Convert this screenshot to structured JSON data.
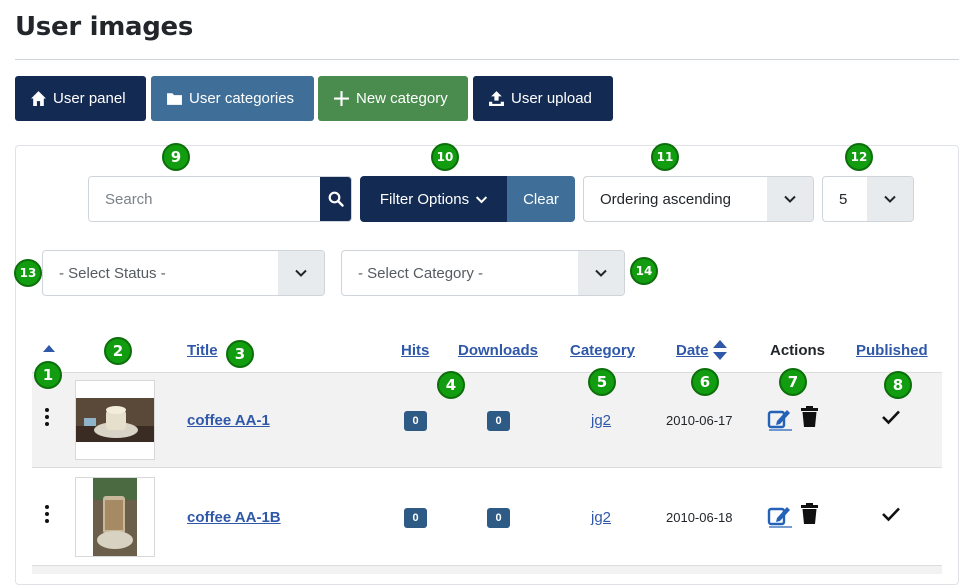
{
  "page": {
    "title": "User images"
  },
  "toolbar": {
    "user_panel": "User panel",
    "user_categories": "User categories",
    "new_category": "New category",
    "user_upload": "User upload"
  },
  "filters": {
    "search_placeholder": "Search",
    "filter_options": "Filter Options",
    "clear": "Clear",
    "ordering": "Ordering ascending",
    "limit": "5",
    "status": "- Select Status -",
    "category": "- Select Category -"
  },
  "table": {
    "headers": {
      "title": "Title",
      "hits": "Hits",
      "downloads": "Downloads",
      "category": "Category",
      "date": "Date",
      "actions": "Actions",
      "published": "Published"
    },
    "rows": [
      {
        "title": "coffee AA-1",
        "hits": "0",
        "downloads": "0",
        "category": "jg2",
        "date": "2010-06-17",
        "published": true
      },
      {
        "title": "coffee AA-1B",
        "hits": "0",
        "downloads": "0",
        "category": "jg2",
        "date": "2010-06-18",
        "published": true
      }
    ]
  },
  "markers": [
    "1",
    "2",
    "3",
    "4",
    "5",
    "6",
    "7",
    "8",
    "9",
    "10",
    "11",
    "12",
    "13",
    "14"
  ],
  "colors": {
    "navy": "#132a52",
    "steel": "#3f6f98",
    "green": "#4a8c4e",
    "marker": "#129c10",
    "link": "#2f58a9"
  },
  "icons": [
    "home-icon",
    "folder-icon",
    "plus-icon",
    "upload-icon",
    "search-icon",
    "chevron-down-icon",
    "caret-up-icon",
    "sort-icon",
    "kebab-icon",
    "edit-icon",
    "trash-icon",
    "check-icon"
  ]
}
